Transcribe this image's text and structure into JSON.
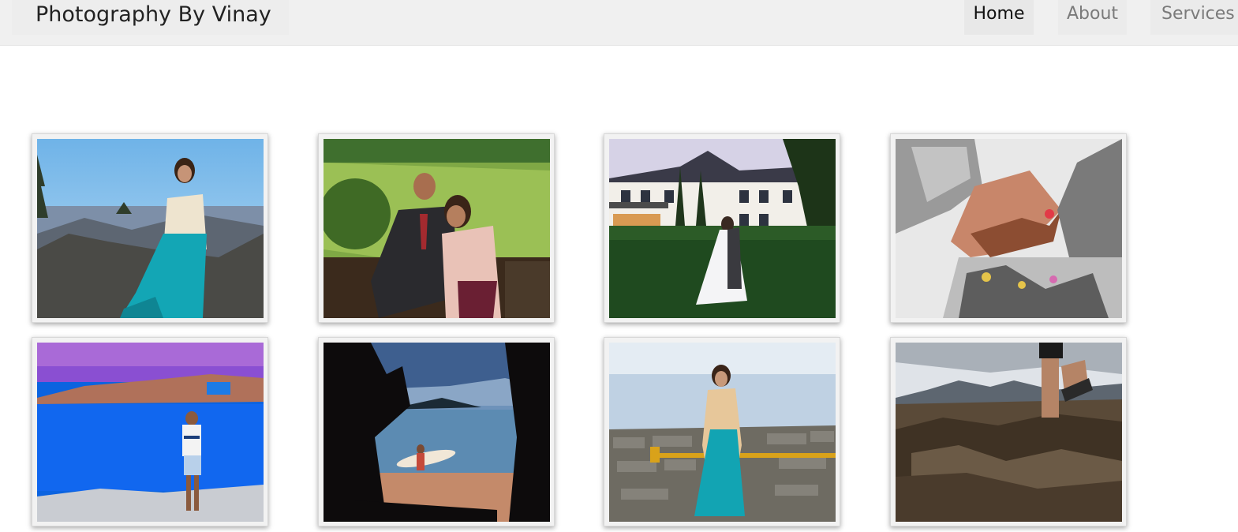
{
  "navbar": {
    "brand": "Photography By Vinay",
    "items": [
      {
        "label": "Home",
        "active": true
      },
      {
        "label": "About",
        "active": false
      },
      {
        "label": "Services",
        "active": false
      }
    ]
  },
  "gallery": {
    "photos": [
      {
        "subject": "woman-on-mountain-rocks"
      },
      {
        "subject": "couple-on-park-bench"
      },
      {
        "subject": "wedding-couple-mansion"
      },
      {
        "subject": "bridal-henna-foot"
      },
      {
        "subject": "man-at-blue-sea"
      },
      {
        "subject": "surfer-through-tree"
      },
      {
        "subject": "woman-by-stone-wall"
      },
      {
        "subject": "runner-on-rocks"
      }
    ]
  },
  "colors": {
    "navbar_bg": "#f0f0f0",
    "tile_bg": "#f2f2f2",
    "nav_active": "#111111",
    "nav_inactive": "#7a7a7a"
  }
}
